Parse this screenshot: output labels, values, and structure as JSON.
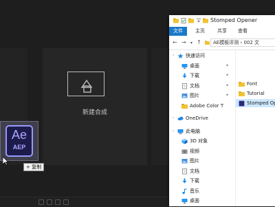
{
  "ae": {
    "new_composition_label": "新建合成",
    "dragged_file": {
      "icon_text": "Ae",
      "extension": "AEP",
      "drag_tooltip": "+ 复制"
    }
  },
  "explorer": {
    "window_title": "Stomped Opener",
    "ribbon_tabs": [
      "文件",
      "主页",
      "共享",
      "查看"
    ],
    "address_path": "AE模板评测 › 002 文",
    "nav_items": [
      {
        "label": "快速访问",
        "icon": "star-icon",
        "color": "#1e88e5",
        "pinned": false,
        "level": 0
      },
      {
        "label": "桌面",
        "icon": "desktop-icon",
        "color": "#2196f3",
        "pinned": true,
        "level": 1
      },
      {
        "label": "下载",
        "icon": "download-icon",
        "color": "#1e88e5",
        "pinned": true,
        "level": 1
      },
      {
        "label": "文档",
        "icon": "document-icon",
        "color": "#8a8a8a",
        "pinned": true,
        "level": 1
      },
      {
        "label": "图片",
        "icon": "picture-icon",
        "color": "#4a90d9",
        "pinned": true,
        "level": 1
      },
      {
        "label": "Adobe Color T",
        "icon": "folder-icon",
        "color": "#f0c330",
        "pinned": false,
        "level": 1
      },
      {
        "label": "OneDrive",
        "icon": "cloud-icon",
        "color": "#1e88e5",
        "pinned": false,
        "level": 0
      },
      {
        "label": "此电脑",
        "icon": "computer-icon",
        "color": "#2196f3",
        "pinned": false,
        "level": 0
      },
      {
        "label": "3D 对象",
        "icon": "cube-icon",
        "color": "#42a5f5",
        "pinned": false,
        "level": 1
      },
      {
        "label": "视频",
        "icon": "video-icon",
        "color": "#7a7a7a",
        "pinned": false,
        "level": 1
      },
      {
        "label": "图片",
        "icon": "picture-icon",
        "color": "#4a90d9",
        "pinned": false,
        "level": 1
      },
      {
        "label": "文档",
        "icon": "document-icon",
        "color": "#8a8a8a",
        "pinned": false,
        "level": 1
      },
      {
        "label": "下载",
        "icon": "download-icon",
        "color": "#1e88e5",
        "pinned": false,
        "level": 1
      },
      {
        "label": "音乐",
        "icon": "music-icon",
        "color": "#1e88e5",
        "pinned": false,
        "level": 1
      },
      {
        "label": "桌面",
        "icon": "desktop-icon",
        "color": "#2196f3",
        "pinned": false,
        "level": 1
      }
    ],
    "files": [
      {
        "label": "Font",
        "icon": "folder-icon",
        "color": "#f0c330",
        "selected": false
      },
      {
        "label": "Tutorial",
        "icon": "folder-icon",
        "color": "#f0c330",
        "selected": false
      },
      {
        "label": "Stomped Opener",
        "icon": "aep-file-icon",
        "color": "#2a2a6e",
        "selected": true
      }
    ]
  }
}
